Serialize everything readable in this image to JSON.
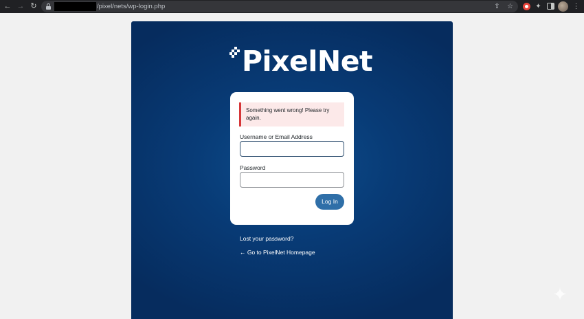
{
  "browser": {
    "url": "/pixel/nets/wp-login.php",
    "icons": {
      "back": "arrow-left",
      "forward": "arrow-right",
      "reload": "reload",
      "lock": "lock",
      "share": "share",
      "bookmark": "star",
      "extension": "red-circle-extension",
      "extensions": "puzzle",
      "side_panel": "side-panel",
      "profile": "avatar",
      "menu": "kebab-menu"
    }
  },
  "page": {
    "logo_text": "PixelNet",
    "error_message": "Something went wrong! Please try again.",
    "form": {
      "username_label": "Username or Email Address",
      "username_value": "",
      "password_label": "Password",
      "password_value": "",
      "submit_label": "Log In"
    },
    "links": {
      "lost_password": "Lost your password?",
      "back_home": "← Go to PixelNet Homepage"
    }
  },
  "colors": {
    "panel_blue": "#083b76",
    "error_border": "#d63638",
    "error_bg": "#fce9e9",
    "button_blue": "#2f6fa8"
  }
}
